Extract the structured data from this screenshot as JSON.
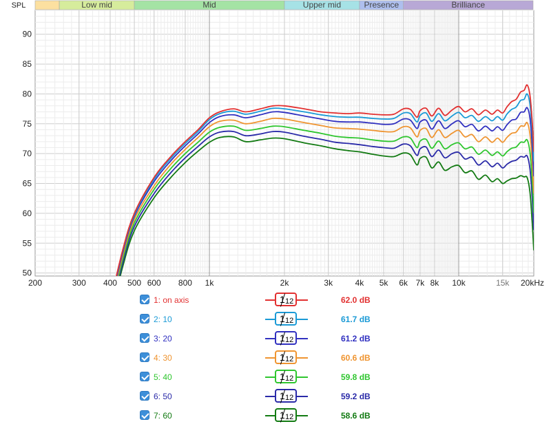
{
  "chart_data": {
    "type": "line",
    "ylabel": "SPL",
    "x_scale": "log",
    "xlim": [
      200,
      20000
    ],
    "ylim": [
      49.5,
      94
    ],
    "x_ticks": [
      {
        "value": 200,
        "label": "200"
      },
      {
        "value": 300,
        "label": "300"
      },
      {
        "value": 400,
        "label": "400"
      },
      {
        "value": 500,
        "label": "500"
      },
      {
        "value": 600,
        "label": "600"
      },
      {
        "value": 800,
        "label": "800"
      },
      {
        "value": 1000,
        "label": "1k"
      },
      {
        "value": 2000,
        "label": "2k"
      },
      {
        "value": 3000,
        "label": "3k"
      },
      {
        "value": 4000,
        "label": "4k"
      },
      {
        "value": 5000,
        "label": "5k"
      },
      {
        "value": 6000,
        "label": "6k"
      },
      {
        "value": 7000,
        "label": "7k"
      },
      {
        "value": 8000,
        "label": "8k"
      },
      {
        "value": 10000,
        "label": "10k"
      },
      {
        "value": 15000,
        "label": "15k"
      },
      {
        "value": 20000,
        "label": "20kHz"
      }
    ],
    "y_ticks": [
      50,
      55,
      60,
      65,
      70,
      75,
      80,
      85,
      90
    ],
    "grid": true,
    "bands": [
      {
        "label": "",
        "from": 200,
        "to": 250,
        "color": "#fce0a0"
      },
      {
        "label": "Low mid",
        "from": 250,
        "to": 500,
        "color": "#d6ec9c"
      },
      {
        "label": "Mid",
        "from": 500,
        "to": 2000,
        "color": "#a4e3a4"
      },
      {
        "label": "Upper mid",
        "from": 2000,
        "to": 4000,
        "color": "#a6e2e6"
      },
      {
        "label": "Presence",
        "from": 4000,
        "to": 6000,
        "color": "#aebfee"
      },
      {
        "label": "Brilliance",
        "from": 6000,
        "to": 20000,
        "color": "#b8a8d6"
      }
    ],
    "series": [
      {
        "name": "1: on axis",
        "color": "#e23030",
        "smoothing": "1/12",
        "level": "62.0 dB",
        "x": [
          400,
          450,
          500,
          600,
          700,
          800,
          900,
          1000,
          1100,
          1250,
          1400,
          1600,
          1800,
          2000,
          2400,
          2800,
          3200,
          3600,
          4000,
          4500,
          5000,
          5500,
          6000,
          6400,
          6800,
          7000,
          7400,
          7800,
          8300,
          8800,
          9400,
          10000,
          10600,
          11300,
          12000,
          12800,
          13600,
          14300,
          15000,
          15600,
          16300,
          17000,
          17700,
          18300,
          18800,
          19300,
          19700,
          20000
        ],
        "y": [
          45,
          54,
          60,
          66,
          69.5,
          72,
          74,
          76,
          77,
          77.5,
          77,
          77.5,
          78,
          78,
          77.5,
          77,
          76.8,
          76.7,
          76.8,
          76.6,
          76.5,
          76.6,
          77.5,
          77.4,
          76.1,
          77.2,
          77.6,
          76.3,
          77.6,
          76.4,
          77.3,
          77.9,
          77.0,
          77.5,
          76.5,
          77.3,
          76.6,
          77.3,
          76.8,
          77.8,
          78.7,
          79.1,
          80.3,
          80.6,
          81.5,
          79.8,
          75.5,
          70.3
        ]
      },
      {
        "name": "2: 10",
        "color": "#1a9ad6",
        "smoothing": "1/12",
        "level": "61.7 dB",
        "x": [
          400,
          450,
          500,
          600,
          700,
          800,
          900,
          1000,
          1100,
          1250,
          1400,
          1600,
          1800,
          2000,
          2400,
          2800,
          3200,
          3600,
          4000,
          4500,
          5000,
          5500,
          6000,
          6400,
          6800,
          7000,
          7400,
          7800,
          8300,
          8800,
          9400,
          10000,
          10600,
          11300,
          12000,
          12800,
          13600,
          14300,
          15000,
          15600,
          16300,
          17000,
          17700,
          18300,
          18800,
          19300,
          19700,
          20000
        ],
        "y": [
          44.8,
          53.8,
          59.8,
          65.7,
          69.2,
          71.7,
          73.7,
          75.7,
          76.7,
          77.1,
          76.6,
          77.1,
          77.6,
          77.5,
          77,
          76.5,
          76.2,
          76.1,
          76.1,
          75.9,
          75.8,
          75.9,
          76.8,
          76.7,
          75.3,
          76.4,
          76.8,
          75.4,
          76.7,
          75.5,
          76.3,
          76.9,
          76.0,
          76.4,
          75.4,
          76.2,
          75.5,
          76.2,
          75.6,
          76.6,
          77.4,
          77.8,
          78.9,
          79.1,
          80.0,
          78.3,
          73.9,
          68.7
        ]
      },
      {
        "name": "3: 20",
        "color": "#3030c0",
        "smoothing": "1/12",
        "level": "61.2 dB",
        "x": [
          400,
          450,
          500,
          600,
          700,
          800,
          900,
          1000,
          1100,
          1250,
          1400,
          1600,
          1800,
          2000,
          2400,
          2800,
          3200,
          3600,
          4000,
          4500,
          5000,
          5500,
          6000,
          6400,
          6800,
          7000,
          7400,
          7800,
          8300,
          8800,
          9400,
          10000,
          10600,
          11300,
          12000,
          12800,
          13600,
          14300,
          15000,
          15600,
          16300,
          17000,
          17700,
          18300,
          18800,
          19300,
          19700,
          20000
        ],
        "y": [
          44.5,
          53.5,
          59.5,
          65.3,
          68.8,
          71.3,
          73.3,
          75.2,
          76.2,
          76.5,
          76,
          76.5,
          77,
          76.9,
          76.3,
          75.8,
          75.4,
          75.3,
          75.3,
          75.1,
          74.9,
          75,
          75.8,
          75.6,
          74.2,
          75.3,
          75.6,
          74.1,
          75.5,
          74.2,
          75,
          75.5,
          74.5,
          74.9,
          73.8,
          74.6,
          73.8,
          74.5,
          73.9,
          74.8,
          75.6,
          75.8,
          76.9,
          77,
          77.7,
          76,
          71.5,
          66.2
        ]
      },
      {
        "name": "4: 30",
        "color": "#ef9430",
        "smoothing": "1/12",
        "level": "60.6 dB",
        "x": [
          400,
          450,
          500,
          600,
          700,
          800,
          900,
          1000,
          1100,
          1250,
          1400,
          1600,
          1800,
          2000,
          2400,
          2800,
          3200,
          3600,
          4000,
          4500,
          5000,
          5500,
          6000,
          6400,
          6800,
          7000,
          7400,
          7800,
          8300,
          8800,
          9400,
          10000,
          10600,
          11300,
          12000,
          12800,
          13600,
          14300,
          15000,
          15600,
          16300,
          17000,
          17700,
          18300,
          18800,
          19300,
          19700,
          20000
        ],
        "y": [
          44,
          53,
          59,
          64.6,
          68.2,
          70.7,
          72.7,
          74.5,
          75.4,
          75.6,
          75,
          75.4,
          75.9,
          75.8,
          75.2,
          74.7,
          74.3,
          74.2,
          74.1,
          73.9,
          73.7,
          73.7,
          74.5,
          74.3,
          72.8,
          73.9,
          74.2,
          72.7,
          74,
          72.7,
          73.4,
          73.9,
          72.8,
          73.2,
          72.0,
          72.8,
          71.9,
          72.6,
          71.9,
          72.7,
          73.4,
          73.6,
          74.6,
          74.6,
          75.2,
          73.3,
          68.7,
          63.3
        ]
      },
      {
        "name": "5: 40",
        "color": "#2ec62e",
        "smoothing": "1/12",
        "level": "59.8 dB",
        "x": [
          400,
          450,
          500,
          600,
          700,
          800,
          900,
          1000,
          1100,
          1250,
          1400,
          1600,
          1800,
          2000,
          2400,
          2800,
          3200,
          3600,
          4000,
          4500,
          5000,
          5500,
          6000,
          6400,
          6800,
          7000,
          7400,
          7800,
          8300,
          8800,
          9400,
          10000,
          10600,
          11300,
          12000,
          12800,
          13600,
          14300,
          15000,
          15600,
          16300,
          17000,
          17700,
          18300,
          18800,
          19300,
          19700,
          20000
        ],
        "y": [
          43.5,
          52.4,
          58.4,
          64,
          67.5,
          70,
          71.9,
          73.6,
          74.4,
          74.6,
          73.9,
          74.2,
          74.6,
          74.5,
          73.9,
          73.4,
          72.9,
          72.7,
          72.6,
          72.3,
          72.1,
          72.1,
          72.8,
          72.6,
          71.0,
          72.1,
          72.4,
          70.9,
          72.1,
          70.8,
          71.5,
          71.8,
          70.8,
          71.1,
          69.9,
          70.6,
          69.7,
          70.3,
          69.6,
          70.3,
          70.9,
          71.1,
          71.9,
          71.9,
          72.3,
          70.3,
          65.6,
          60.1
        ]
      },
      {
        "name": "6: 50",
        "color": "#2a2aa8",
        "smoothing": "1/12",
        "level": "59.2 dB",
        "x": [
          400,
          450,
          500,
          600,
          700,
          800,
          900,
          1000,
          1100,
          1250,
          1400,
          1600,
          1800,
          2000,
          2400,
          2800,
          3200,
          3600,
          4000,
          4500,
          5000,
          5500,
          6000,
          6400,
          6800,
          7000,
          7400,
          7800,
          8300,
          8800,
          9400,
          10000,
          10600,
          11300,
          12000,
          12800,
          13600,
          14300,
          15000,
          15600,
          16300,
          17000,
          17700,
          18300,
          18800,
          19300,
          19700,
          20000
        ],
        "y": [
          43,
          51.8,
          57.8,
          63.3,
          66.8,
          69.3,
          71.2,
          72.8,
          73.6,
          73.7,
          73,
          73.3,
          73.7,
          73.6,
          72.9,
          72.4,
          71.9,
          71.7,
          71.5,
          71.2,
          71,
          70.9,
          71.6,
          71.3,
          69.7,
          70.8,
          71.1,
          69.5,
          70.6,
          69.3,
          70,
          70.2,
          69.1,
          69.4,
          68.1,
          68.8,
          67.8,
          68.4,
          67.6,
          68.2,
          68.7,
          68.9,
          69.5,
          69.4,
          69.6,
          67.5,
          62.7,
          57.2
        ]
      },
      {
        "name": "7: 60",
        "color": "#127a12",
        "smoothing": "1/12",
        "level": "58.6 dB",
        "x": [
          400,
          450,
          500,
          600,
          700,
          800,
          900,
          1000,
          1100,
          1250,
          1400,
          1600,
          1800,
          2000,
          2400,
          2800,
          3200,
          3600,
          4000,
          4500,
          5000,
          5500,
          6000,
          6400,
          6800,
          7000,
          7400,
          7800,
          8300,
          8800,
          9400,
          10000,
          10600,
          11300,
          12000,
          12800,
          13600,
          14300,
          15000,
          15600,
          16300,
          17000,
          17700,
          18300,
          18800,
          19300,
          19700,
          20000
        ],
        "y": [
          42.5,
          51.2,
          57.1,
          62.6,
          66,
          68.5,
          70.4,
          71.9,
          72.7,
          72.8,
          72,
          72.3,
          72.6,
          72.5,
          71.8,
          71.3,
          70.8,
          70.5,
          70.3,
          69.9,
          69.6,
          69.5,
          70.1,
          69.8,
          68.1,
          69.2,
          69.4,
          67.6,
          68.6,
          67.2,
          67.8,
          68.0,
          66.8,
          67.1,
          65.7,
          66.4,
          65.3,
          65.8,
          65.0,
          65.4,
          65.8,
          65.9,
          66.3,
          66.1,
          66.0,
          63.6,
          58.6,
          53.8
        ]
      }
    ]
  }
}
